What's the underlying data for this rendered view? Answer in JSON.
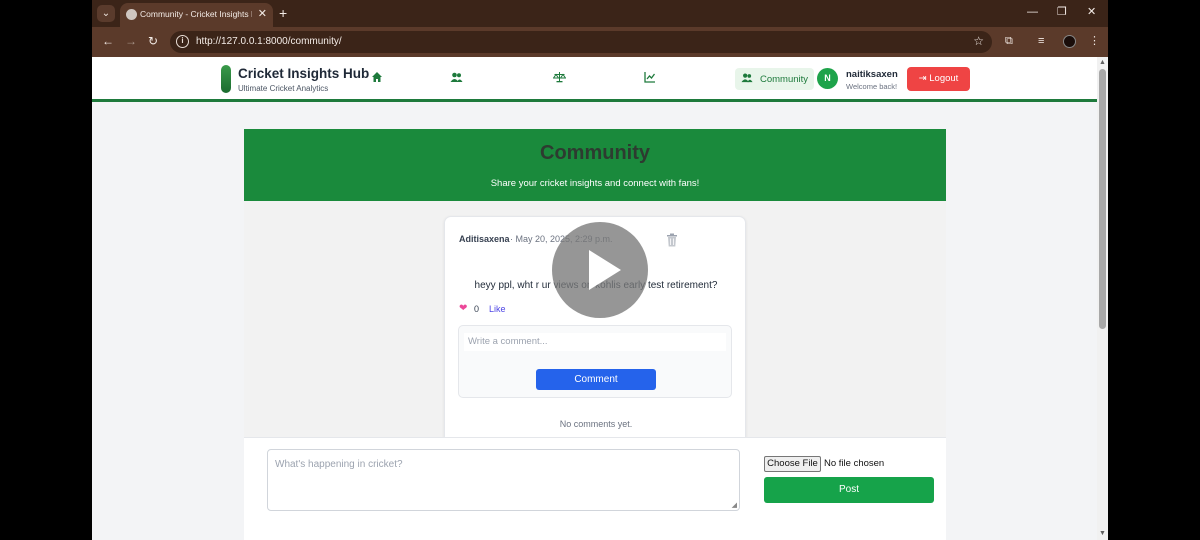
{
  "browser": {
    "tab_title": "Community - Cricket Insights H",
    "tab_close": "✕",
    "new_tab": "+",
    "url": "http://127.0.0.1:8000/community/",
    "minimize": "—",
    "maximize": "❐",
    "close": "✕"
  },
  "navbar": {
    "brand": "Cricket Insights Hub",
    "tagline": "Ultimate Cricket Analytics",
    "community_label": "Community",
    "avatar_initial": "N",
    "username": "naitiksaxen",
    "welcome": "Welcome back!",
    "logout_label": "Logout",
    "icons": [
      "home-icon",
      "users-icon",
      "balance-scale-icon",
      "line-chart-icon"
    ]
  },
  "hero": {
    "title": "Community",
    "subtitle": "Share your cricket insights and connect with fans!"
  },
  "post": {
    "author": "Aditisaxena",
    "time": "· May 20, 2025, 2:29 p.m.",
    "text": "heyy ppl, wht r ur views on kohlis early test retirement?",
    "likes": "0",
    "like_label": "Like",
    "comment_placeholder": "Write a comment...",
    "comment_button": "Comment",
    "no_comments": "No comments yet."
  },
  "compose": {
    "placeholder": "What's happening in cricket?",
    "choose_file": "Choose File",
    "file_status": "No file chosen",
    "post_button": "Post"
  },
  "colors": {
    "brand_green": "#1a8a3c",
    "logout_red": "#ef4444",
    "comment_blue": "#2563eb",
    "post_green": "#16a34a"
  }
}
